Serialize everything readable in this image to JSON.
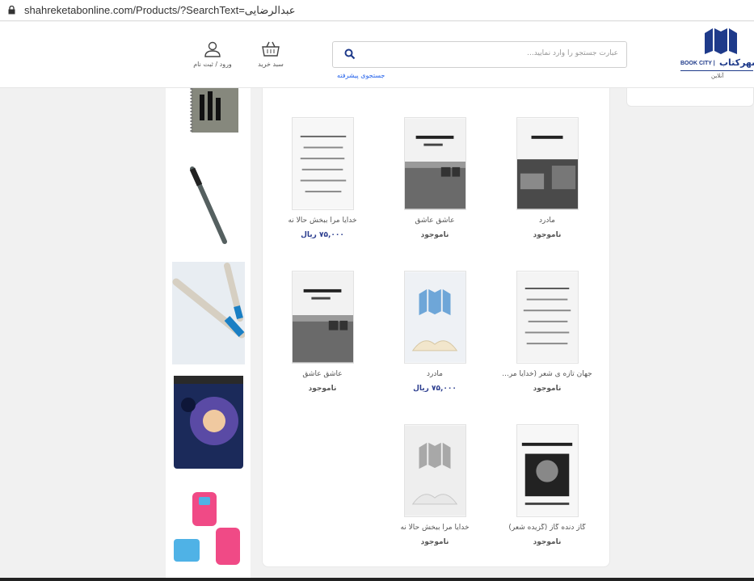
{
  "browser": {
    "url": "shahreketabonline.com/Products/?SearchText=عبدالرضایی"
  },
  "header": {
    "logo_en": "BOOK CITY |",
    "logo_fa": "شهرکتاب",
    "logo_sub": "آنلاین",
    "search_placeholder": "عبارت جستجو را وارد نمایید...",
    "advanced_search": "جستجوی پیشرفته",
    "cart_label": "سبد خرید",
    "login_label": "ورود / ثبت نام"
  },
  "colors": {
    "accent": "#2c3e8f",
    "brand": "#1e3a8a",
    "link": "#2563eb"
  },
  "products": [
    {
      "title": "مادرد",
      "price": "",
      "status": "ناموجود",
      "cover": "photo-madard"
    },
    {
      "title": "عاشق عاشق",
      "price": "",
      "status": "ناموجود",
      "cover": "photo-ashegh"
    },
    {
      "title": "خدایا مرا ببخش حالا نه",
      "price": "۷۵,۰۰۰ ریال",
      "status": "",
      "cover": "photo-khodaya"
    },
    {
      "title": "جهان تازه ی شعر (خدایا مر...",
      "price": "",
      "status": "ناموجود",
      "cover": "photo-jahan"
    },
    {
      "title": "مادرد",
      "price": "۷۵,۰۰۰ ریال",
      "status": "",
      "cover": "placeholder-blue"
    },
    {
      "title": "عاشق عاشق",
      "price": "",
      "status": "ناموجود",
      "cover": "photo-ashegh"
    },
    {
      "title": "گاز دنده گاز (گزیده شعر)",
      "price": "",
      "status": "ناموجود",
      "cover": "photo-gaz"
    },
    {
      "title": "خدایا مرا ببخش حالا نه",
      "price": "",
      "status": "ناموجود",
      "cover": "placeholder-gray"
    }
  ],
  "side_thumbs": [
    "notebook",
    "pen",
    "pens",
    "sharpener-galaxy",
    "sharpeners-pink"
  ]
}
